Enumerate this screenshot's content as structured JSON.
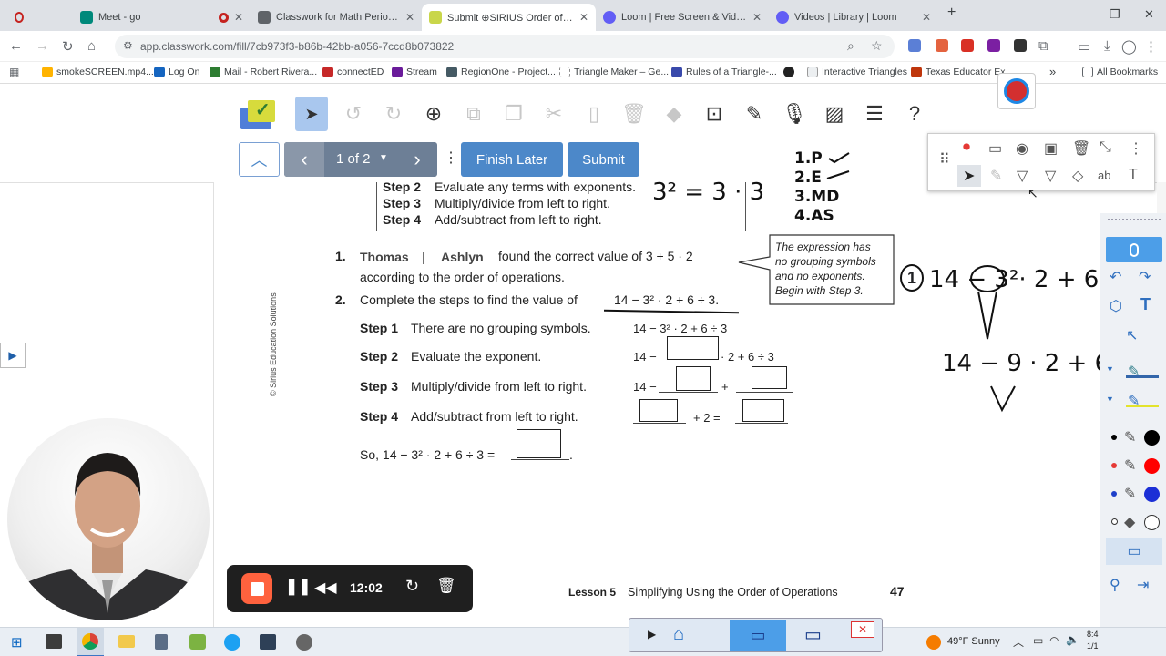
{
  "browser": {
    "tabs": [
      {
        "title": "Meet - go",
        "icon": "google-meet-icon",
        "recording": true
      },
      {
        "title": "Classwork for Math Period 1",
        "icon": "classroom-icon",
        "recording": true
      },
      {
        "title": "Submit ⊕SIRIUS Order of Ope",
        "icon": "classwork-icon",
        "active": true
      },
      {
        "title": "Loom | Free Screen & Video Re",
        "icon": "loom-icon"
      },
      {
        "title": "Videos | Library | Loom",
        "icon": "loom-icon"
      }
    ],
    "new_tab": "+",
    "url": "app.classwork.com/fill/7cb973f3-b86b-42bb-a056-7ccd8b073822",
    "bookmarks": [
      "smokeSCREEN.mp4...",
      "Log On",
      "Mail - Robert Rivera...",
      "connectED",
      "Stream",
      "RegionOne - Project...",
      "Triangle Maker – Ge...",
      "Rules of a Triangle-...",
      "",
      "Interactive Triangles",
      "Texas Educator Ex..."
    ],
    "bookmarks_more": "»",
    "all_bookmarks": "All Bookmarks"
  },
  "classwork": {
    "toolbar_icons": [
      "app-logo-icon",
      "select-icon",
      "undo-icon",
      "redo-icon",
      "zoom-in-icon",
      "copy-icon",
      "duplicate-icon",
      "cut-icon",
      "paste-icon",
      "delete-icon",
      "eraser-icon",
      "crop-icon",
      "pen-icon",
      "microphone-icon",
      "image-icon",
      "notes-icon",
      "help-icon"
    ],
    "help_label": "?",
    "pager": {
      "label": "1 of 2",
      "prev": "‹",
      "next": "›"
    },
    "finish_later": "Finish Later",
    "submit": "Submit",
    "more": "⋮"
  },
  "worksheet": {
    "table_rows": [
      {
        "step": "Step 2",
        "text": "Evaluate any terms with exponents."
      },
      {
        "step": "Step 3",
        "text": "Multiply/divide from left to right."
      },
      {
        "step": "Step 4",
        "text": "Add/subtract from left to right."
      }
    ],
    "q1_number": "1.",
    "q1_choice_a": "Thomas",
    "q1_sep": "|",
    "q1_choice_b": "Ashlyn",
    "q1_text": "found the correct value of 3 + 5 · 2",
    "q1_text2": "according to the order of operations.",
    "callout": [
      "The expression has",
      "no grouping symbols",
      "and no exponents.",
      "Begin with Step 3."
    ],
    "q2_number": "2.",
    "q2_text": "Complete the steps to find the value of",
    "q2_expr": "14 − 3² · 2 + 6 ÷ 3.",
    "steps": [
      {
        "label": "Step 1",
        "text": "There are no grouping symbols.",
        "work": "14 − 3² · 2 + 6 ÷ 3"
      },
      {
        "label": "Step 2",
        "text": "Evaluate the exponent.",
        "work_a": "14 −",
        "work_b": "· 2 + 6 ÷ 3"
      },
      {
        "label": "Step 3",
        "text": "Multiply/divide from left to right.",
        "work_a": "14 −",
        "work_b": "+"
      },
      {
        "label": "Step 4",
        "text": "Add/subtract from left to right.",
        "work_a": "+ 2 ="
      }
    ],
    "so_text": "So, 14 − 3² · 2 + 6 ÷ 3 =",
    "so_period": ".",
    "copyright": "© Sirius Education Solutions",
    "footer_lesson": "Lesson 5",
    "footer_title": "Simplifying Using the Order of Operations",
    "page_number": "47"
  },
  "annotations": {
    "exponent_note": "3² = 3 · 3",
    "pemdas": [
      "1.P",
      "2.E",
      "3.MD",
      "4.AS"
    ],
    "circled_one": "1",
    "expr1": "14 − 3²· 2 + 6 ÷ 3",
    "expr2": "14 − 9 · 2 + 6 ÷ 3"
  },
  "recorder": {
    "time": "12:02"
  },
  "taskbar": {
    "weather": "49°F  Sunny",
    "clock": "8:4",
    "date": "1/1"
  }
}
